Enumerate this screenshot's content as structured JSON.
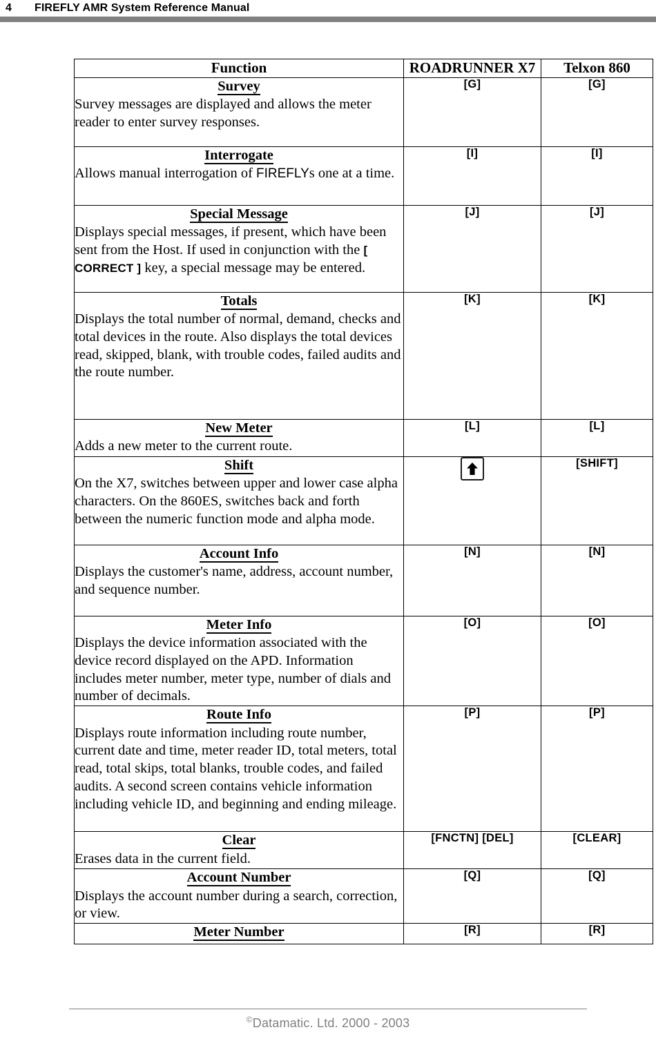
{
  "header": {
    "page_number": "4",
    "title": "FIREFLY AMR System Reference Manual",
    "rule_color": "#808080"
  },
  "table": {
    "columns": [
      {
        "key": "function",
        "label": "Function"
      },
      {
        "key": "roadrunner_x7",
        "label": "ROADRUNNER X7"
      },
      {
        "key": "telxon_860",
        "label": "Telxon 860"
      }
    ],
    "rows": [
      {
        "title": "Survey",
        "description": "Survey messages are displayed and allows the meter reader to enter survey responses.",
        "roadrunner_x7": "[G]",
        "telxon_860": "[G]"
      },
      {
        "title": "Interrogate",
        "description": "Allows manual interrogation of FIREFLYs one at a time.",
        "description_parts": [
          {
            "text": "Allows manual interrogation of ",
            "style": "serif"
          },
          {
            "text": "FIREFLY",
            "style": "sans"
          },
          {
            "text": "s one at a time.",
            "style": "serif"
          }
        ],
        "roadrunner_x7": "[I]",
        "telxon_860": "[I]"
      },
      {
        "title": "Special Message",
        "description": "Displays special messages, if present, which have been sent from the Host.  If used in conjunction with the [ CORRECT ] key, a special message may be entered.",
        "description_parts": [
          {
            "text": "Displays special messages, if present, which have been sent from the Host.  If used in conjunction with the ",
            "style": "serif"
          },
          {
            "text": "[ CORRECT ]",
            "style": "sans-bold"
          },
          {
            "text": " key, a special message may be entered.",
            "style": "serif"
          }
        ],
        "roadrunner_x7": "[J]",
        "telxon_860": "[J]"
      },
      {
        "title": "Totals",
        "description": "Displays the total number of normal, demand, checks and total devices in the route.  Also displays the total devices read, skipped, blank, with trouble codes, failed audits and the route number.",
        "roadrunner_x7": "[K]",
        "telxon_860": "[K]"
      },
      {
        "title": "New Meter",
        "description": "Adds a new meter to the current route.",
        "roadrunner_x7": "[L]",
        "telxon_860": "[L]"
      },
      {
        "title": "Shift",
        "description": "On the X7, switches between upper and lower case alpha characters.  On the 860ES, switches back and forth between the numeric function mode and alpha mode.",
        "roadrunner_x7": "",
        "roadrunner_x7_icon": "shift-up-arrow-key-icon",
        "telxon_860": "[SHIFT]"
      },
      {
        "title": "Account Info",
        "description": "Displays the customer's name, address, account number, and sequence number.",
        "roadrunner_x7": "[N]",
        "telxon_860": "[N]"
      },
      {
        "title": "Meter Info",
        "description": "Displays the device information associated with the device record displayed on the APD.  Information includes meter number, meter type, number of dials and number of decimals.",
        "roadrunner_x7": "[O]",
        "telxon_860": "[O]"
      },
      {
        "title": "Route Info",
        "description": "Displays route information including route number, current date and time, meter reader ID, total meters, total read, total skips, total blanks, trouble codes, and failed audits.  A second screen contains vehicle information including vehicle ID, and beginning and ending mileage.",
        "roadrunner_x7": "[P]",
        "telxon_860": "[P]"
      },
      {
        "title": "Clear",
        "description": "Erases data in the current field.",
        "roadrunner_x7": "[FNCTN] [DEL]",
        "telxon_860": "[CLEAR]"
      },
      {
        "title": "Account Number",
        "description": "Displays the account number during a search, correction, or view.",
        "roadrunner_x7": "[Q]",
        "telxon_860": "[Q]"
      },
      {
        "title": "Meter Number",
        "description": "",
        "roadrunner_x7": "[R]",
        "telxon_860": "[R]"
      }
    ]
  },
  "footer": {
    "copyright_mark": "©",
    "text": "Datamatic. Ltd. 2000 - 2003",
    "color": "#808080"
  }
}
